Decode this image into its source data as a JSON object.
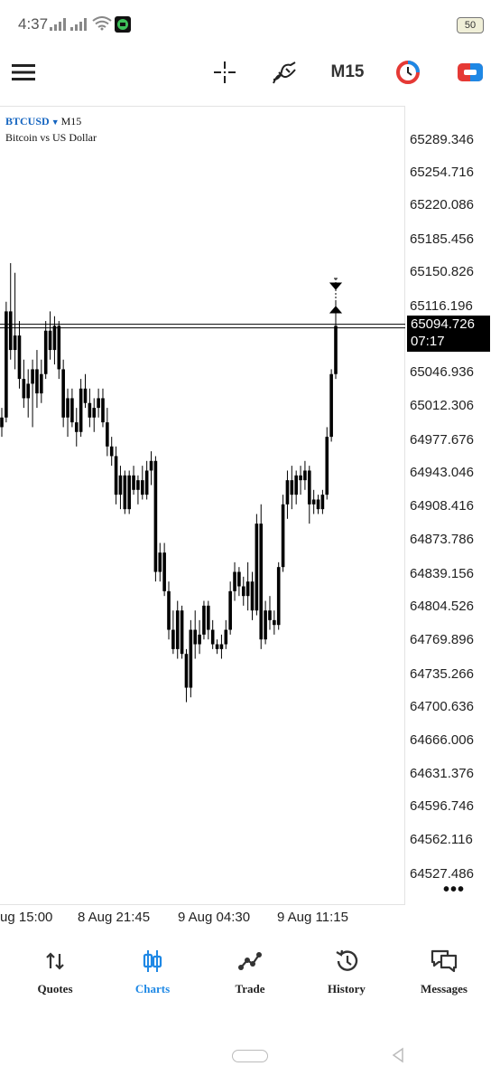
{
  "status_bar": {
    "time": "4:37",
    "battery": "50"
  },
  "toolbar": {
    "timeframe": "M15"
  },
  "chart": {
    "symbol": "BTCUSD",
    "timeframe": "M15",
    "description": "Bitcoin vs US Dollar",
    "current_price": "65094.726",
    "countdown": "07:17",
    "price_labels": [
      "65289.346",
      "65254.716",
      "65220.086",
      "65185.456",
      "65150.826",
      "65116.196",
      "65046.936",
      "65012.306",
      "64977.676",
      "64943.046",
      "64908.416",
      "64873.786",
      "64839.156",
      "64804.526",
      "64769.896",
      "64735.266",
      "64700.636",
      "64666.006",
      "64631.376",
      "64596.746",
      "64562.116",
      "64527.486"
    ],
    "time_labels": [
      "ug 15:00",
      "8 Aug 21:45",
      "9 Aug 04:30",
      "9 Aug 11:15"
    ]
  },
  "chart_data": {
    "type": "candlestick",
    "symbol": "BTCUSD",
    "timeframe": "M15",
    "ylim": [
      64510,
      65305
    ],
    "x_ticks": [
      "ug 15:00",
      "8 Aug 21:45",
      "9 Aug 04:30",
      "9 Aug 11:15"
    ],
    "current_price": 65094.726,
    "candles": [
      {
        "o": 64990,
        "h": 65010,
        "l": 64980,
        "c": 65000
      },
      {
        "o": 65000,
        "h": 65120,
        "l": 64995,
        "c": 65110
      },
      {
        "o": 65110,
        "h": 65160,
        "l": 65060,
        "c": 65070
      },
      {
        "o": 65070,
        "h": 65150,
        "l": 65050,
        "c": 65085
      },
      {
        "o": 65085,
        "h": 65100,
        "l": 65030,
        "c": 65040
      },
      {
        "o": 65040,
        "h": 65060,
        "l": 65010,
        "c": 65020
      },
      {
        "o": 65020,
        "h": 65050,
        "l": 65000,
        "c": 65035
      },
      {
        "o": 65035,
        "h": 65060,
        "l": 64990,
        "c": 65050
      },
      {
        "o": 65050,
        "h": 65070,
        "l": 65010,
        "c": 65025
      },
      {
        "o": 65025,
        "h": 65060,
        "l": 65015,
        "c": 65045
      },
      {
        "o": 65045,
        "h": 65100,
        "l": 65040,
        "c": 65090
      },
      {
        "o": 65090,
        "h": 65110,
        "l": 65060,
        "c": 65070
      },
      {
        "o": 65070,
        "h": 65105,
        "l": 65055,
        "c": 65095
      },
      {
        "o": 65095,
        "h": 65100,
        "l": 65040,
        "c": 65050
      },
      {
        "o": 65050,
        "h": 65060,
        "l": 64990,
        "c": 65000
      },
      {
        "o": 65000,
        "h": 65030,
        "l": 64980,
        "c": 65020
      },
      {
        "o": 65020,
        "h": 65030,
        "l": 64990,
        "c": 64995
      },
      {
        "o": 64995,
        "h": 65010,
        "l": 64970,
        "c": 64985
      },
      {
        "o": 64985,
        "h": 65040,
        "l": 64980,
        "c": 65030
      },
      {
        "o": 65030,
        "h": 65045,
        "l": 65010,
        "c": 65015
      },
      {
        "o": 65015,
        "h": 65030,
        "l": 64990,
        "c": 65000
      },
      {
        "o": 65000,
        "h": 65020,
        "l": 64985,
        "c": 65010
      },
      {
        "o": 65010,
        "h": 65030,
        "l": 65000,
        "c": 65020
      },
      {
        "o": 65020,
        "h": 65030,
        "l": 64990,
        "c": 64995
      },
      {
        "o": 64995,
        "h": 65010,
        "l": 64960,
        "c": 64970
      },
      {
        "o": 64970,
        "h": 64980,
        "l": 64950,
        "c": 64960
      },
      {
        "o": 64960,
        "h": 64970,
        "l": 64910,
        "c": 64920
      },
      {
        "o": 64920,
        "h": 64950,
        "l": 64905,
        "c": 64940
      },
      {
        "o": 64940,
        "h": 64945,
        "l": 64900,
        "c": 64905
      },
      {
        "o": 64905,
        "h": 64945,
        "l": 64900,
        "c": 64940
      },
      {
        "o": 64940,
        "h": 64950,
        "l": 64920,
        "c": 64925
      },
      {
        "o": 64925,
        "h": 64940,
        "l": 64910,
        "c": 64935
      },
      {
        "o": 64935,
        "h": 64950,
        "l": 64915,
        "c": 64920
      },
      {
        "o": 64920,
        "h": 64955,
        "l": 64915,
        "c": 64945
      },
      {
        "o": 64945,
        "h": 64965,
        "l": 64930,
        "c": 64955
      },
      {
        "o": 64955,
        "h": 64960,
        "l": 64830,
        "c": 64840
      },
      {
        "o": 64840,
        "h": 64870,
        "l": 64830,
        "c": 64860
      },
      {
        "o": 64860,
        "h": 64870,
        "l": 64815,
        "c": 64820
      },
      {
        "o": 64820,
        "h": 64830,
        "l": 64770,
        "c": 64780
      },
      {
        "o": 64780,
        "h": 64800,
        "l": 64755,
        "c": 64760
      },
      {
        "o": 64760,
        "h": 64810,
        "l": 64750,
        "c": 64800
      },
      {
        "o": 64800,
        "h": 64805,
        "l": 64750,
        "c": 64755
      },
      {
        "o": 64755,
        "h": 64760,
        "l": 64705,
        "c": 64720
      },
      {
        "o": 64720,
        "h": 64790,
        "l": 64710,
        "c": 64780
      },
      {
        "o": 64780,
        "h": 64800,
        "l": 64750,
        "c": 64765
      },
      {
        "o": 64765,
        "h": 64790,
        "l": 64755,
        "c": 64775
      },
      {
        "o": 64775,
        "h": 64810,
        "l": 64770,
        "c": 64805
      },
      {
        "o": 64805,
        "h": 64810,
        "l": 64770,
        "c": 64780
      },
      {
        "o": 64780,
        "h": 64790,
        "l": 64760,
        "c": 64765
      },
      {
        "o": 64765,
        "h": 64770,
        "l": 64755,
        "c": 64760
      },
      {
        "o": 64760,
        "h": 64775,
        "l": 64750,
        "c": 64765
      },
      {
        "o": 64765,
        "h": 64790,
        "l": 64760,
        "c": 64780
      },
      {
        "o": 64780,
        "h": 64830,
        "l": 64775,
        "c": 64820
      },
      {
        "o": 64820,
        "h": 64850,
        "l": 64810,
        "c": 64840
      },
      {
        "o": 64840,
        "h": 64845,
        "l": 64815,
        "c": 64825
      },
      {
        "o": 64825,
        "h": 64835,
        "l": 64805,
        "c": 64815
      },
      {
        "o": 64815,
        "h": 64850,
        "l": 64800,
        "c": 64830
      },
      {
        "o": 64830,
        "h": 64840,
        "l": 64790,
        "c": 64800
      },
      {
        "o": 64800,
        "h": 64900,
        "l": 64795,
        "c": 64890
      },
      {
        "o": 64890,
        "h": 64910,
        "l": 64760,
        "c": 64770
      },
      {
        "o": 64770,
        "h": 64810,
        "l": 64765,
        "c": 64800
      },
      {
        "o": 64800,
        "h": 64815,
        "l": 64780,
        "c": 64790
      },
      {
        "o": 64790,
        "h": 64800,
        "l": 64775,
        "c": 64785
      },
      {
        "o": 64785,
        "h": 64850,
        "l": 64780,
        "c": 64845
      },
      {
        "o": 64845,
        "h": 64920,
        "l": 64840,
        "c": 64910
      },
      {
        "o": 64910,
        "h": 64945,
        "l": 64895,
        "c": 64935
      },
      {
        "o": 64935,
        "h": 64950,
        "l": 64905,
        "c": 64920
      },
      {
        "o": 64920,
        "h": 64945,
        "l": 64910,
        "c": 64940
      },
      {
        "o": 64940,
        "h": 64950,
        "l": 64920,
        "c": 64935
      },
      {
        "o": 64935,
        "h": 64955,
        "l": 64925,
        "c": 64945
      },
      {
        "o": 64945,
        "h": 64950,
        "l": 64890,
        "c": 64910
      },
      {
        "o": 64910,
        "h": 64925,
        "l": 64900,
        "c": 64915
      },
      {
        "o": 64915,
        "h": 64920,
        "l": 64900,
        "c": 64905
      },
      {
        "o": 64905,
        "h": 64925,
        "l": 64900,
        "c": 64920
      },
      {
        "o": 64920,
        "h": 64990,
        "l": 64915,
        "c": 64980
      },
      {
        "o": 64980,
        "h": 65050,
        "l": 64975,
        "c": 65045
      },
      {
        "o": 65045,
        "h": 65120,
        "l": 65040,
        "c": 65095
      }
    ]
  },
  "nav": {
    "items": [
      {
        "label": "Quotes",
        "icon": "sort-arrows-icon"
      },
      {
        "label": "Charts",
        "icon": "candles-icon"
      },
      {
        "label": "Trade",
        "icon": "trend-icon"
      },
      {
        "label": "History",
        "icon": "history-icon"
      },
      {
        "label": "Messages",
        "icon": "chat-icon"
      }
    ]
  },
  "colors": {
    "accent": "#1e88e5",
    "candle": "#000000",
    "notif_red": "#e53935"
  }
}
